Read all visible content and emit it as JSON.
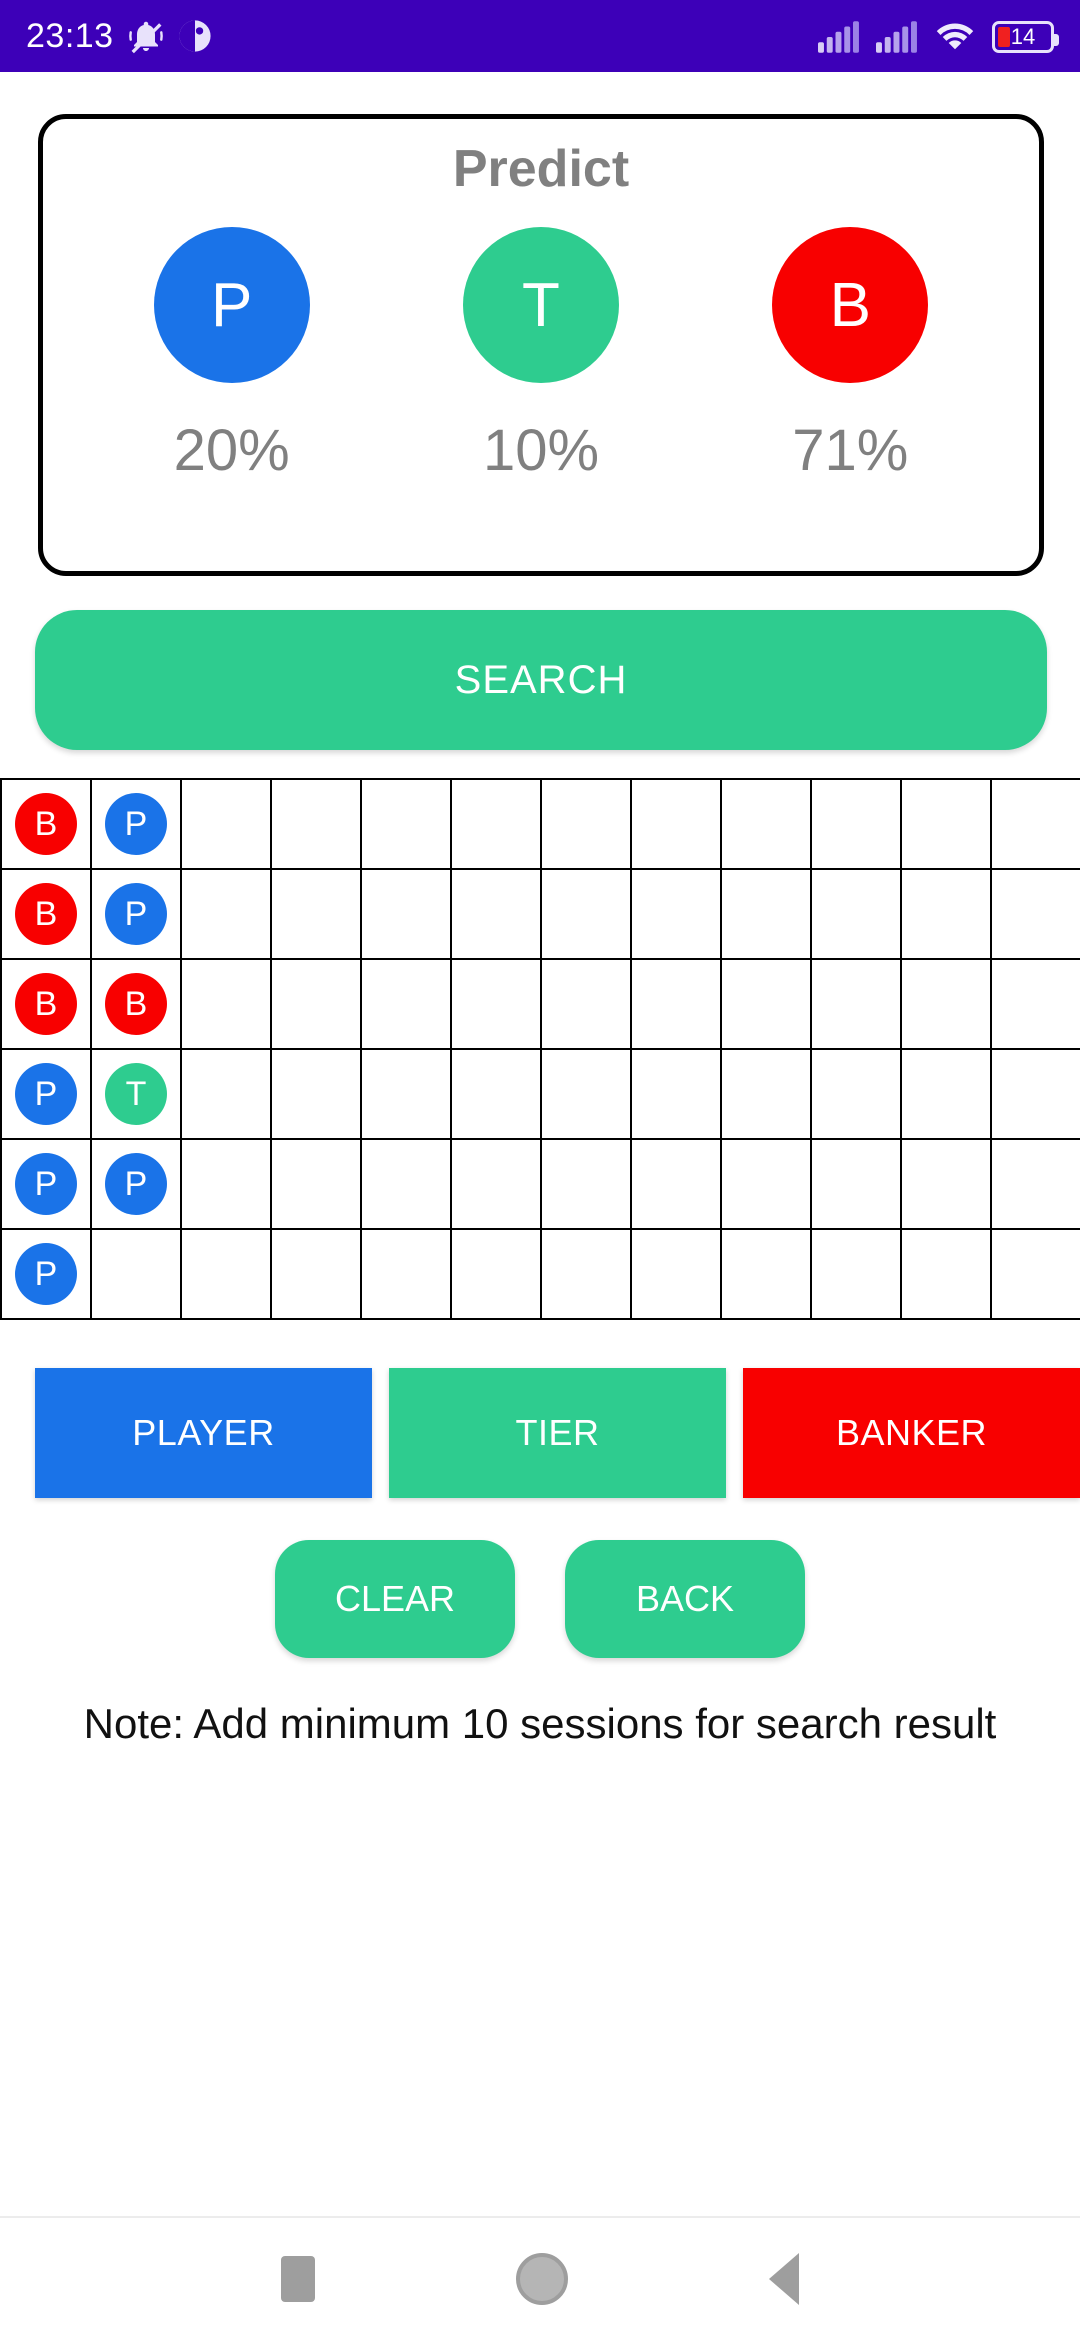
{
  "status_bar": {
    "time": "23:13",
    "battery_percent": "14",
    "icons": [
      "bell-mute-icon",
      "app-dot-icon",
      "signal-icon",
      "signal-icon",
      "wifi-icon",
      "battery-icon"
    ],
    "background_color": "#3d00b8"
  },
  "predict": {
    "title": "Predict",
    "options": [
      {
        "letter": "P",
        "percent": "20%",
        "color": "#1a73e8",
        "name": "player"
      },
      {
        "letter": "T",
        "percent": "10%",
        "color": "#2ecc8f",
        "name": "tier"
      },
      {
        "letter": "B",
        "percent": "71%",
        "color": "#f80000",
        "name": "banker"
      }
    ]
  },
  "search_button": {
    "label": "SEARCH",
    "color": "#2ecc8f"
  },
  "grid": {
    "columns": 12,
    "rows": 6,
    "cells": [
      [
        "B",
        "P",
        "",
        "",
        "",
        "",
        "",
        "",
        "",
        "",
        "",
        ""
      ],
      [
        "B",
        "P",
        "",
        "",
        "",
        "",
        "",
        "",
        "",
        "",
        "",
        ""
      ],
      [
        "B",
        "B",
        "",
        "",
        "",
        "",
        "",
        "",
        "",
        "",
        "",
        ""
      ],
      [
        "P",
        "T",
        "",
        "",
        "",
        "",
        "",
        "",
        "",
        "",
        "",
        ""
      ],
      [
        "P",
        "P",
        "",
        "",
        "",
        "",
        "",
        "",
        "",
        "",
        "",
        ""
      ],
      [
        "P",
        "",
        "",
        "",
        "",
        "",
        "",
        "",
        "",
        "",
        "",
        ""
      ]
    ],
    "mark_colors": {
      "P": "#1a73e8",
      "T": "#2ecc8f",
      "B": "#f80000"
    }
  },
  "entry_buttons": [
    {
      "label": "PLAYER",
      "color": "#1a73e8",
      "name": "player"
    },
    {
      "label": "TIER",
      "color": "#2ecc8f",
      "name": "tier"
    },
    {
      "label": "BANKER",
      "color": "#f80000",
      "name": "banker"
    }
  ],
  "control_buttons": [
    {
      "label": "CLEAR",
      "color": "#2ecc8f",
      "name": "clear"
    },
    {
      "label": "BACK",
      "color": "#2ecc8f",
      "name": "back"
    }
  ],
  "note": "Note: Add minimum 10 sessions for search result",
  "nav_bar": {
    "recents": "recents-square-icon",
    "home": "home-circle-icon",
    "back": "back-triangle-icon"
  }
}
